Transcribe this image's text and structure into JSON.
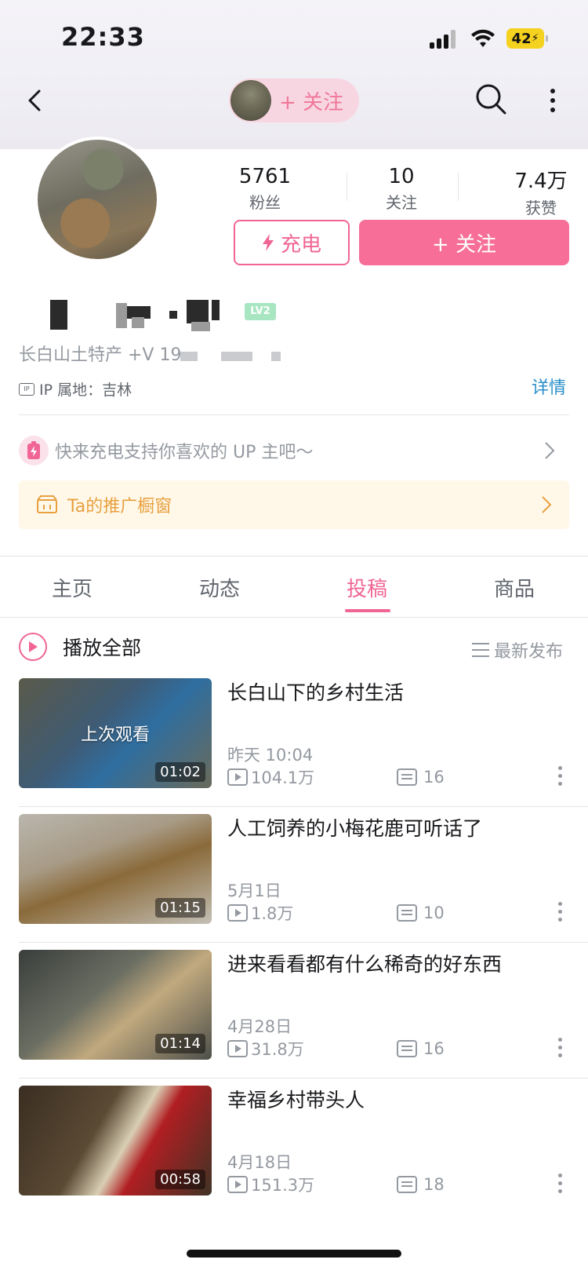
{
  "status_bar": {
    "time": "22:33",
    "battery": "42"
  },
  "nav": {
    "mini_follow_label": "+ 关注"
  },
  "profile": {
    "stats": [
      {
        "value": "5761",
        "label": "粉丝"
      },
      {
        "value": "10",
        "label": "关注"
      },
      {
        "value": "7.4万",
        "label": "获赞"
      }
    ],
    "charge_button": "充电",
    "follow_button": "+ 关注",
    "level_badge": "LV2",
    "bio": "长白山土特产 +V 19",
    "ip_location": "IP 属地：吉林",
    "detail_link": "详情",
    "charge_tip": "快来充电支持你喜欢的 UP 主吧～",
    "shop_window": "Ta的推广橱窗"
  },
  "tabs": [
    {
      "label": "主页",
      "active": false
    },
    {
      "label": "动态",
      "active": false
    },
    {
      "label": "投稿",
      "active": true
    },
    {
      "label": "商品",
      "active": false
    }
  ],
  "list_header": {
    "play_all": "播放全部",
    "sort": "最新发布"
  },
  "videos": [
    {
      "title": "长白山下的乡村生活",
      "date": "昨天 10:04",
      "views": "104.1万",
      "danmaku": "16",
      "duration": "01:02",
      "watched_tag": "上次观看"
    },
    {
      "title": "人工饲养的小梅花鹿可听话了",
      "date": "5月1日",
      "views": "1.8万",
      "danmaku": "10",
      "duration": "01:15"
    },
    {
      "title": "进来看看都有什么稀奇的好东西",
      "date": "4月28日",
      "views": "31.8万",
      "danmaku": "16",
      "duration": "01:14"
    },
    {
      "title": "幸福乡村带头人",
      "date": "4月18日",
      "views": "151.3万",
      "danmaku": "18",
      "duration": "00:58"
    }
  ],
  "colors": {
    "accent_pink": "#f06595",
    "follow_pink": "#f76f99",
    "link_blue": "#2a8fc9",
    "shop_orange": "#e8a040",
    "muted_gray": "#9499a0"
  }
}
